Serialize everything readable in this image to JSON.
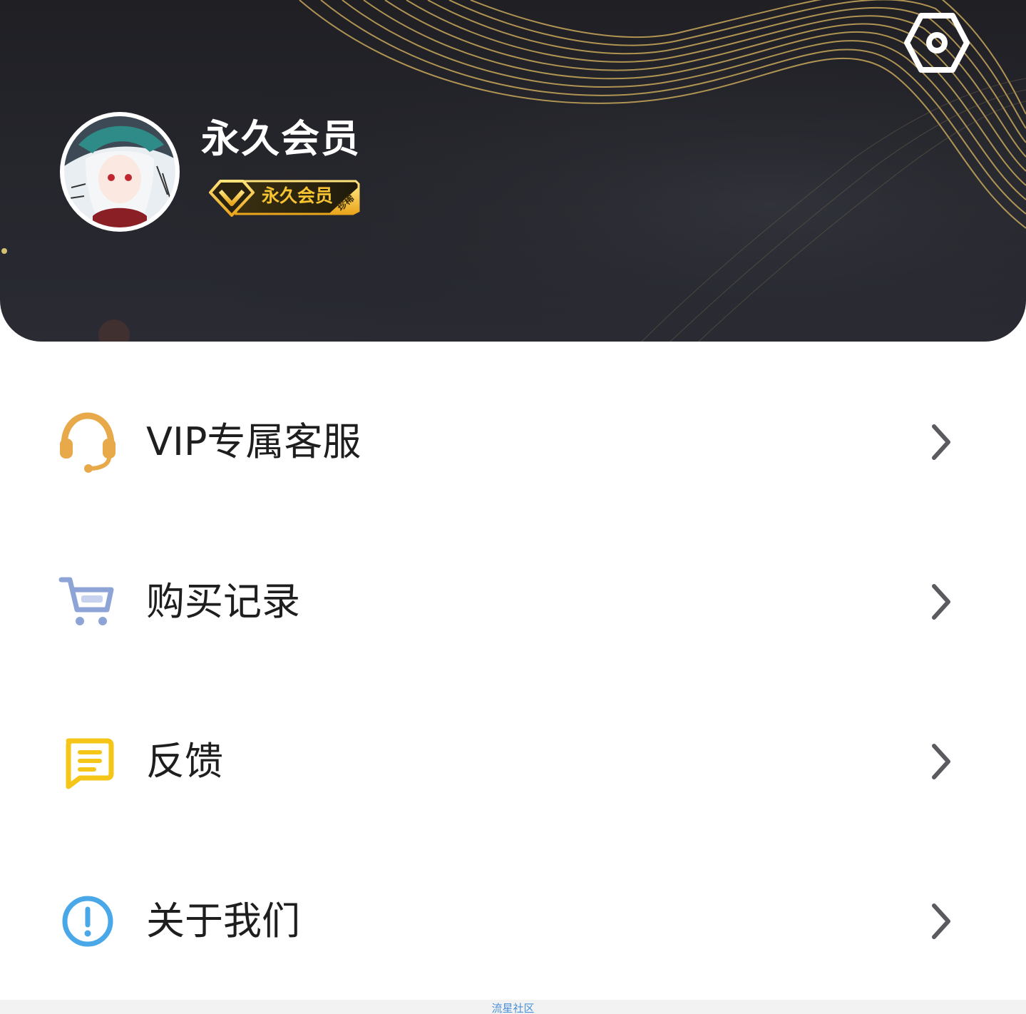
{
  "header": {
    "username": "永久会员",
    "vip_badge": {
      "label": "永久会员",
      "corner_label": "珍稀"
    },
    "settings_icon": "settings-hexagon-icon",
    "background_color": "#25262c",
    "accent_color": "#f7c431"
  },
  "menu": {
    "items": [
      {
        "label": "VIP专属客服",
        "icon": "headset-icon",
        "icon_color": "#e8a94a"
      },
      {
        "label": "购买记录",
        "icon": "shopping-cart-icon",
        "icon_color": "#8fa4d6"
      },
      {
        "label": "反馈",
        "icon": "feedback-message-icon",
        "icon_color": "#f5c518"
      },
      {
        "label": "关于我们",
        "icon": "info-circle-icon",
        "icon_color": "#4aa8e8"
      }
    ]
  },
  "footer": {
    "watermark": "流星社区"
  }
}
